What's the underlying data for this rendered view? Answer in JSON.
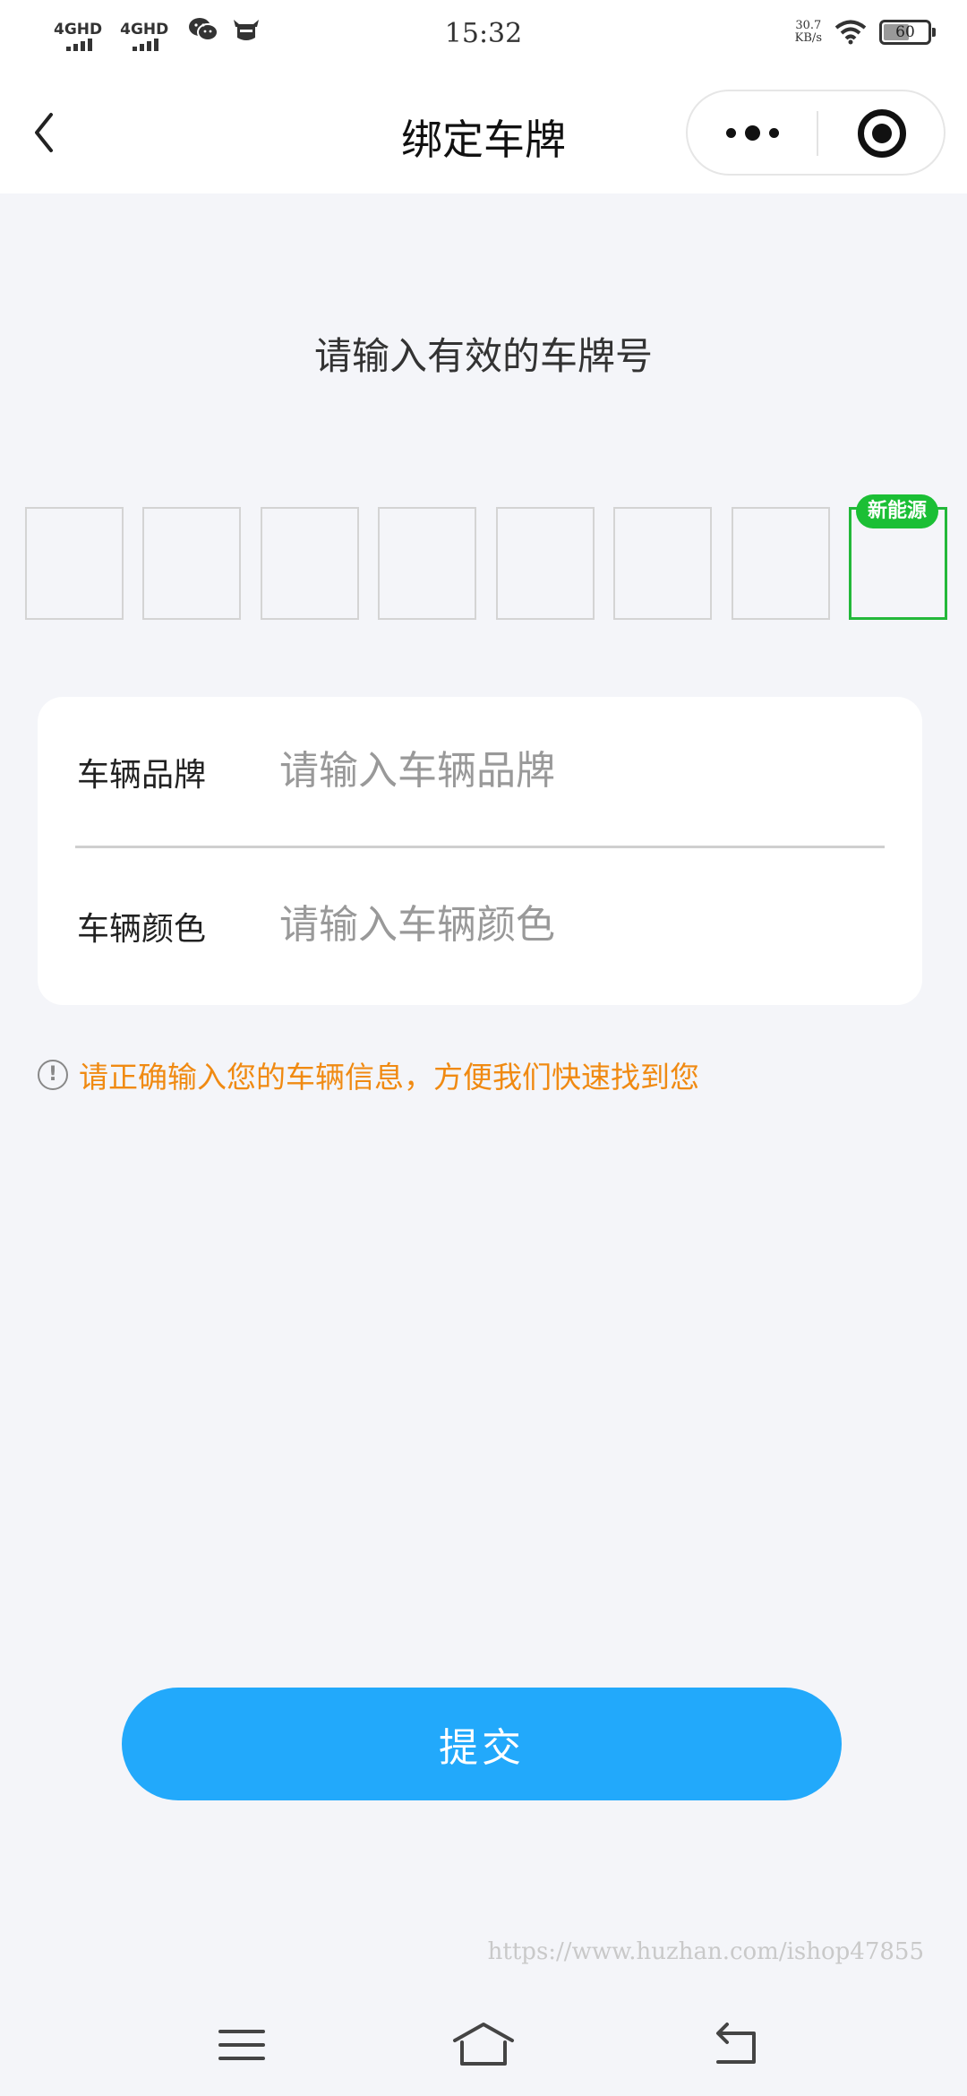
{
  "status_bar": {
    "signal1": "4GHD",
    "signal2": "4GHD",
    "time": "15:32",
    "speed_value": "30.7",
    "speed_unit": "KB/s",
    "battery": "60",
    "icons": [
      "signal-icon",
      "signal-icon",
      "wechat-icon",
      "cow-icon",
      "wifi-icon",
      "battery-icon"
    ]
  },
  "nav": {
    "title": "绑定车牌",
    "back_icon": "chevron-left-icon",
    "more_icon": "more-dots-icon",
    "close_icon": "target-circle-icon"
  },
  "plate": {
    "prompt": "请输入有效的车牌号",
    "boxes": [
      "",
      "",
      "",
      "",
      "",
      "",
      "",
      ""
    ],
    "ev_badge": "新能源",
    "ev_color": "#1bbf35"
  },
  "form": {
    "brand_label": "车辆品牌",
    "brand_placeholder": "请输入车辆品牌",
    "brand_value": "",
    "color_label": "车辆颜色",
    "color_placeholder": "请输入车辆颜色",
    "color_value": ""
  },
  "tip": {
    "icon": "info-circle-icon",
    "text": "请正确输入您的车辆信息，方便我们快速找到您",
    "color": "#f08a12"
  },
  "submit": {
    "label": "提交",
    "color": "#22a9fb"
  },
  "watermark": "https://www.huzhan.com/ishop47855",
  "system_nav": [
    "menu-icon",
    "home-icon",
    "back-icon"
  ]
}
